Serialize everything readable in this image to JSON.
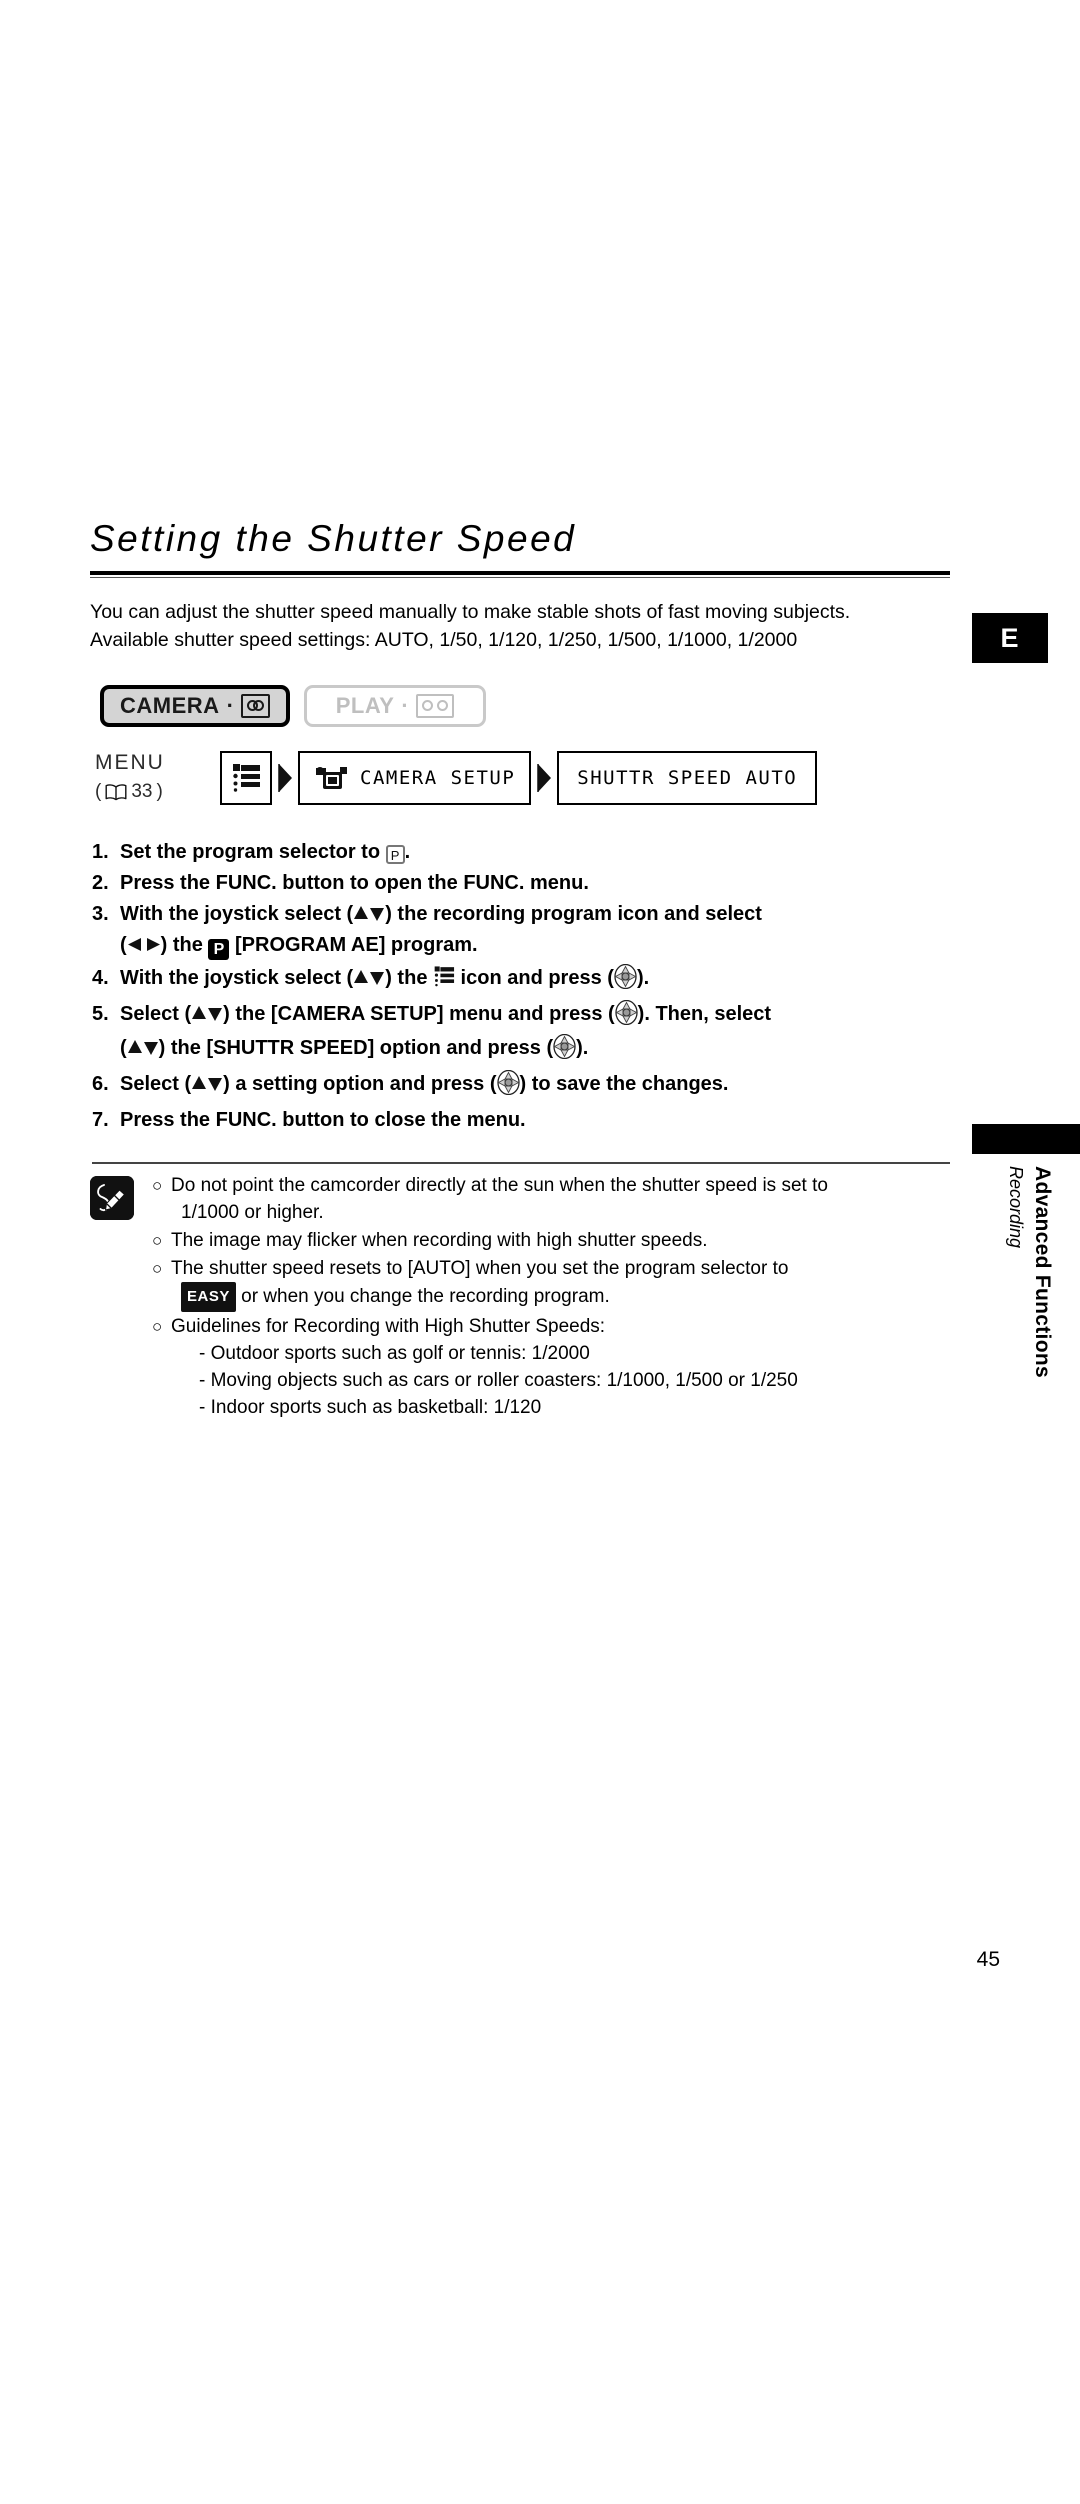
{
  "document": {
    "page_number": "45",
    "language_tab": "E",
    "side_tab": {
      "main": "Advanced Functions",
      "sub": "Recording"
    }
  },
  "title": "Setting the Shutter Speed",
  "intro": {
    "line1": "You can adjust the shutter speed manually to make stable shots of fast moving subjects.",
    "line2": "Available shutter speed settings: AUTO, 1/50, 1/120, 1/250, 1/500, 1/1000, 1/2000"
  },
  "modes": {
    "camera": {
      "label": "CAMERA",
      "separator": "·",
      "icon": "tape-icon",
      "state": "active"
    },
    "play": {
      "label": "PLAY",
      "separator": "·",
      "icon": "tape-icon",
      "state": "inactive"
    }
  },
  "menu_path": {
    "label": "MENU",
    "page_ref_open": "(",
    "page_ref_icon": "book-icon",
    "page_ref": "33",
    "page_ref_close": ")",
    "steps": [
      {
        "type": "icon",
        "icon": "menu-list-icon"
      },
      {
        "type": "icon_text",
        "icon": "camcorder-icon",
        "text": "CAMERA SETUP"
      },
      {
        "type": "text",
        "text": "SHUTTR SPEED AUTO"
      }
    ]
  },
  "steps": [
    {
      "num": "1.",
      "parts": [
        {
          "t": "text",
          "v": "Set the program selector to "
        },
        {
          "t": "icon",
          "v": "program-ae-outline-icon"
        },
        {
          "t": "text",
          "v": "."
        }
      ]
    },
    {
      "num": "2.",
      "parts": [
        {
          "t": "text",
          "v": "Press the FUNC. button to open the FUNC. menu."
        }
      ]
    },
    {
      "num": "3.",
      "line1": [
        {
          "t": "text",
          "v": "With the joystick select ("
        },
        {
          "t": "icon",
          "v": "triangle-up-down-icon"
        },
        {
          "t": "text",
          "v": ") the recording program icon and select"
        }
      ],
      "line2": [
        {
          "t": "text",
          "v": "("
        },
        {
          "t": "icon",
          "v": "triangle-left-right-icon"
        },
        {
          "t": "text",
          "v": ") the "
        },
        {
          "t": "icon",
          "v": "program-ae-filled-icon"
        },
        {
          "t": "text",
          "v": " [PROGRAM AE] program."
        }
      ]
    },
    {
      "num": "4.",
      "line1": [
        {
          "t": "text",
          "v": "With the joystick select ("
        },
        {
          "t": "icon",
          "v": "triangle-up-down-icon"
        },
        {
          "t": "text",
          "v": ") the "
        },
        {
          "t": "icon",
          "v": "menu-list-icon"
        },
        {
          "t": "text",
          "v": " icon and press ("
        },
        {
          "t": "icon",
          "v": "joystick-icon"
        },
        {
          "t": "text",
          "v": ")."
        }
      ]
    },
    {
      "num": "5.",
      "line1": [
        {
          "t": "text",
          "v": "Select ("
        },
        {
          "t": "icon",
          "v": "triangle-up-down-icon"
        },
        {
          "t": "text",
          "v": ") the [CAMERA SETUP] menu and press ("
        },
        {
          "t": "icon",
          "v": "joystick-icon"
        },
        {
          "t": "text",
          "v": "). Then, select"
        }
      ],
      "line2": [
        {
          "t": "text",
          "v": "("
        },
        {
          "t": "icon",
          "v": "triangle-up-down-icon"
        },
        {
          "t": "text",
          "v": ") the [SHUTTR SPEED] option and press ("
        },
        {
          "t": "icon",
          "v": "joystick-icon"
        },
        {
          "t": "text",
          "v": ")."
        }
      ]
    },
    {
      "num": "6.",
      "line1": [
        {
          "t": "text",
          "v": "Select ("
        },
        {
          "t": "icon",
          "v": "triangle-up-down-icon"
        },
        {
          "t": "text",
          "v": ") a setting option and press ("
        },
        {
          "t": "icon",
          "v": "joystick-icon"
        },
        {
          "t": "text",
          "v": ") to save the changes."
        }
      ]
    },
    {
      "num": "7.",
      "parts": [
        {
          "t": "text",
          "v": "Press the FUNC. button to close the menu."
        }
      ]
    }
  ],
  "notes": {
    "icon": "note-pencil-icon",
    "bullet": "○",
    "items": [
      {
        "line1": "Do not point the camcorder directly at the sun when the shutter speed is set to",
        "line2": "1/1000 or higher."
      },
      {
        "line1": "The image may flicker when recording with high shutter speeds."
      },
      {
        "line1": "The shutter speed resets to [AUTO] when you set the program selector to",
        "badge": "EASY",
        "line2_after_badge": " or when you change the recording program."
      },
      {
        "line1": "Guidelines for Recording with High Shutter Speeds:",
        "sub_items": [
          "-  Outdoor sports such as golf or tennis: 1/2000",
          "-  Moving objects such as cars or roller coasters: 1/1000, 1/500 or 1/250",
          "-  Indoor sports such as basketball: 1/120"
        ]
      }
    ]
  },
  "colors": {
    "ink": "#000000",
    "paper": "#ffffff",
    "active_fill": "#d4d4d4",
    "inactive_text": "#bfbfbf"
  }
}
